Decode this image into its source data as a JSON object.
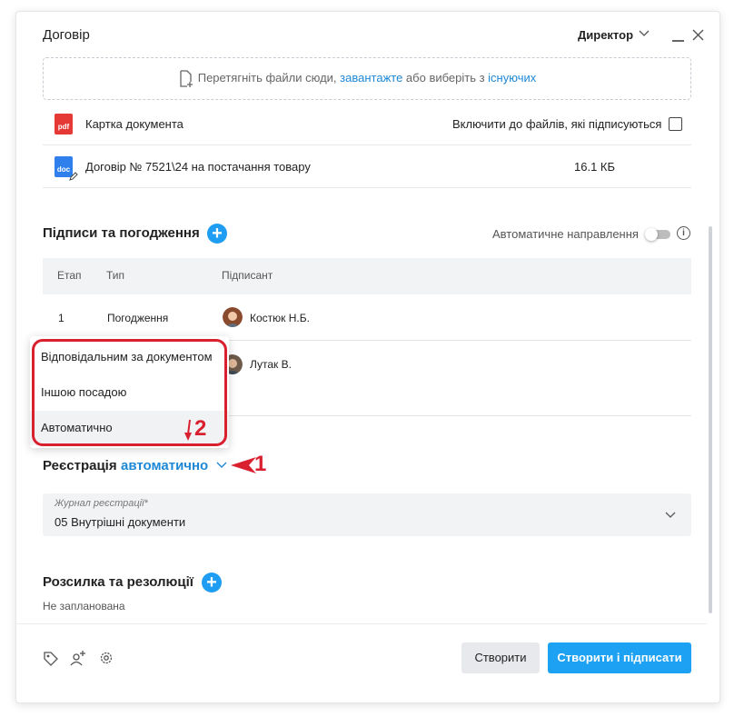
{
  "header": {
    "title": "Договір",
    "role": "Директор"
  },
  "upload": {
    "prefix": "Перетягніть файли сюди, ",
    "upload_link": "завантажте",
    "middle": " або виберіть з ",
    "existing_link": "існуючих"
  },
  "files": [
    {
      "icon": "pdf-icon",
      "icon_text": "pdf",
      "name": "Картка документа",
      "right_text": "Включити до файлів, які підписуються"
    },
    {
      "icon": "doc-icon",
      "icon_text": "doc",
      "name": "Договір № 7521\\24 на постачання товару",
      "size": "16.1 КБ"
    }
  ],
  "signatures": {
    "title": "Підписи та погодження",
    "auto_label": "Автоматичне направлення",
    "columns": [
      "Етап",
      "Тип",
      "Підписант"
    ],
    "rows": [
      {
        "stage": "1",
        "type": "Погодження",
        "signer": "Костюк Н.Б."
      },
      {
        "stage": "",
        "type": "",
        "signer": "Лутак В."
      }
    ]
  },
  "dropdown": {
    "items": [
      "Відповідальним за документом",
      "Іншою посадою",
      "Автоматично"
    ],
    "selected_index": 2
  },
  "annotations": {
    "a1": "1",
    "a2": "2"
  },
  "registration": {
    "title": "Реєстрація",
    "mode": "автоматично",
    "journal_label": "Журнал реєстрації*",
    "journal_value": "05 Внутрішні документи"
  },
  "distribution": {
    "title": "Розсилка та резолюції",
    "status": "Не запланована"
  },
  "footer": {
    "create": "Створити",
    "create_sign": "Створити і підписати"
  },
  "colors": {
    "accent": "#1da1f2",
    "link": "#1e88d6",
    "annotation": "#d9202f"
  }
}
